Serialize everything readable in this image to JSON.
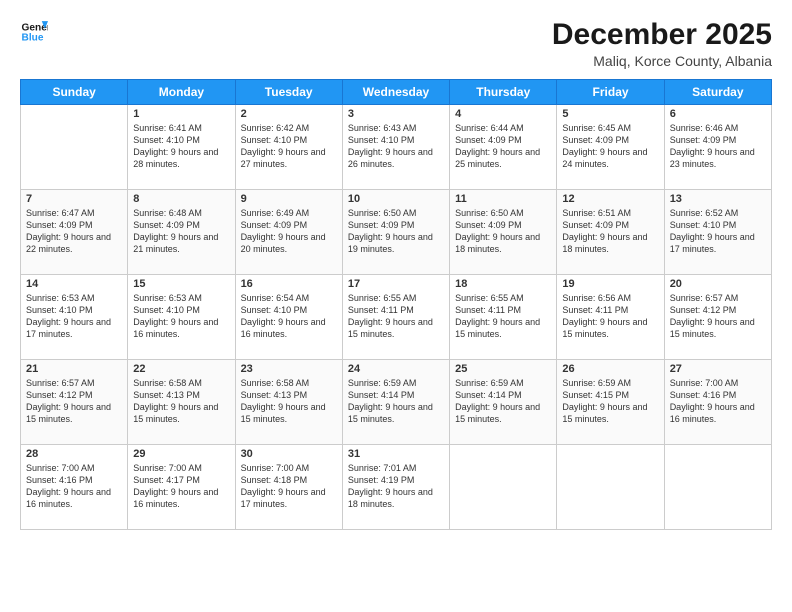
{
  "header": {
    "logo_line1": "General",
    "logo_line2": "Blue",
    "main_title": "December 2025",
    "subtitle": "Maliq, Korce County, Albania"
  },
  "days_of_week": [
    "Sunday",
    "Monday",
    "Tuesday",
    "Wednesday",
    "Thursday",
    "Friday",
    "Saturday"
  ],
  "weeks": [
    [
      {
        "num": "",
        "sunrise": "",
        "sunset": "",
        "daylight": ""
      },
      {
        "num": "1",
        "sunrise": "Sunrise: 6:41 AM",
        "sunset": "Sunset: 4:10 PM",
        "daylight": "Daylight: 9 hours and 28 minutes."
      },
      {
        "num": "2",
        "sunrise": "Sunrise: 6:42 AM",
        "sunset": "Sunset: 4:10 PM",
        "daylight": "Daylight: 9 hours and 27 minutes."
      },
      {
        "num": "3",
        "sunrise": "Sunrise: 6:43 AM",
        "sunset": "Sunset: 4:10 PM",
        "daylight": "Daylight: 9 hours and 26 minutes."
      },
      {
        "num": "4",
        "sunrise": "Sunrise: 6:44 AM",
        "sunset": "Sunset: 4:09 PM",
        "daylight": "Daylight: 9 hours and 25 minutes."
      },
      {
        "num": "5",
        "sunrise": "Sunrise: 6:45 AM",
        "sunset": "Sunset: 4:09 PM",
        "daylight": "Daylight: 9 hours and 24 minutes."
      },
      {
        "num": "6",
        "sunrise": "Sunrise: 6:46 AM",
        "sunset": "Sunset: 4:09 PM",
        "daylight": "Daylight: 9 hours and 23 minutes."
      }
    ],
    [
      {
        "num": "7",
        "sunrise": "Sunrise: 6:47 AM",
        "sunset": "Sunset: 4:09 PM",
        "daylight": "Daylight: 9 hours and 22 minutes."
      },
      {
        "num": "8",
        "sunrise": "Sunrise: 6:48 AM",
        "sunset": "Sunset: 4:09 PM",
        "daylight": "Daylight: 9 hours and 21 minutes."
      },
      {
        "num": "9",
        "sunrise": "Sunrise: 6:49 AM",
        "sunset": "Sunset: 4:09 PM",
        "daylight": "Daylight: 9 hours and 20 minutes."
      },
      {
        "num": "10",
        "sunrise": "Sunrise: 6:50 AM",
        "sunset": "Sunset: 4:09 PM",
        "daylight": "Daylight: 9 hours and 19 minutes."
      },
      {
        "num": "11",
        "sunrise": "Sunrise: 6:50 AM",
        "sunset": "Sunset: 4:09 PM",
        "daylight": "Daylight: 9 hours and 18 minutes."
      },
      {
        "num": "12",
        "sunrise": "Sunrise: 6:51 AM",
        "sunset": "Sunset: 4:09 PM",
        "daylight": "Daylight: 9 hours and 18 minutes."
      },
      {
        "num": "13",
        "sunrise": "Sunrise: 6:52 AM",
        "sunset": "Sunset: 4:10 PM",
        "daylight": "Daylight: 9 hours and 17 minutes."
      }
    ],
    [
      {
        "num": "14",
        "sunrise": "Sunrise: 6:53 AM",
        "sunset": "Sunset: 4:10 PM",
        "daylight": "Daylight: 9 hours and 17 minutes."
      },
      {
        "num": "15",
        "sunrise": "Sunrise: 6:53 AM",
        "sunset": "Sunset: 4:10 PM",
        "daylight": "Daylight: 9 hours and 16 minutes."
      },
      {
        "num": "16",
        "sunrise": "Sunrise: 6:54 AM",
        "sunset": "Sunset: 4:10 PM",
        "daylight": "Daylight: 9 hours and 16 minutes."
      },
      {
        "num": "17",
        "sunrise": "Sunrise: 6:55 AM",
        "sunset": "Sunset: 4:11 PM",
        "daylight": "Daylight: 9 hours and 15 minutes."
      },
      {
        "num": "18",
        "sunrise": "Sunrise: 6:55 AM",
        "sunset": "Sunset: 4:11 PM",
        "daylight": "Daylight: 9 hours and 15 minutes."
      },
      {
        "num": "19",
        "sunrise": "Sunrise: 6:56 AM",
        "sunset": "Sunset: 4:11 PM",
        "daylight": "Daylight: 9 hours and 15 minutes."
      },
      {
        "num": "20",
        "sunrise": "Sunrise: 6:57 AM",
        "sunset": "Sunset: 4:12 PM",
        "daylight": "Daylight: 9 hours and 15 minutes."
      }
    ],
    [
      {
        "num": "21",
        "sunrise": "Sunrise: 6:57 AM",
        "sunset": "Sunset: 4:12 PM",
        "daylight": "Daylight: 9 hours and 15 minutes."
      },
      {
        "num": "22",
        "sunrise": "Sunrise: 6:58 AM",
        "sunset": "Sunset: 4:13 PM",
        "daylight": "Daylight: 9 hours and 15 minutes."
      },
      {
        "num": "23",
        "sunrise": "Sunrise: 6:58 AM",
        "sunset": "Sunset: 4:13 PM",
        "daylight": "Daylight: 9 hours and 15 minutes."
      },
      {
        "num": "24",
        "sunrise": "Sunrise: 6:59 AM",
        "sunset": "Sunset: 4:14 PM",
        "daylight": "Daylight: 9 hours and 15 minutes."
      },
      {
        "num": "25",
        "sunrise": "Sunrise: 6:59 AM",
        "sunset": "Sunset: 4:14 PM",
        "daylight": "Daylight: 9 hours and 15 minutes."
      },
      {
        "num": "26",
        "sunrise": "Sunrise: 6:59 AM",
        "sunset": "Sunset: 4:15 PM",
        "daylight": "Daylight: 9 hours and 15 minutes."
      },
      {
        "num": "27",
        "sunrise": "Sunrise: 7:00 AM",
        "sunset": "Sunset: 4:16 PM",
        "daylight": "Daylight: 9 hours and 16 minutes."
      }
    ],
    [
      {
        "num": "28",
        "sunrise": "Sunrise: 7:00 AM",
        "sunset": "Sunset: 4:16 PM",
        "daylight": "Daylight: 9 hours and 16 minutes."
      },
      {
        "num": "29",
        "sunrise": "Sunrise: 7:00 AM",
        "sunset": "Sunset: 4:17 PM",
        "daylight": "Daylight: 9 hours and 16 minutes."
      },
      {
        "num": "30",
        "sunrise": "Sunrise: 7:00 AM",
        "sunset": "Sunset: 4:18 PM",
        "daylight": "Daylight: 9 hours and 17 minutes."
      },
      {
        "num": "31",
        "sunrise": "Sunrise: 7:01 AM",
        "sunset": "Sunset: 4:19 PM",
        "daylight": "Daylight: 9 hours and 18 minutes."
      },
      {
        "num": "",
        "sunrise": "",
        "sunset": "",
        "daylight": ""
      },
      {
        "num": "",
        "sunrise": "",
        "sunset": "",
        "daylight": ""
      },
      {
        "num": "",
        "sunrise": "",
        "sunset": "",
        "daylight": ""
      }
    ]
  ]
}
